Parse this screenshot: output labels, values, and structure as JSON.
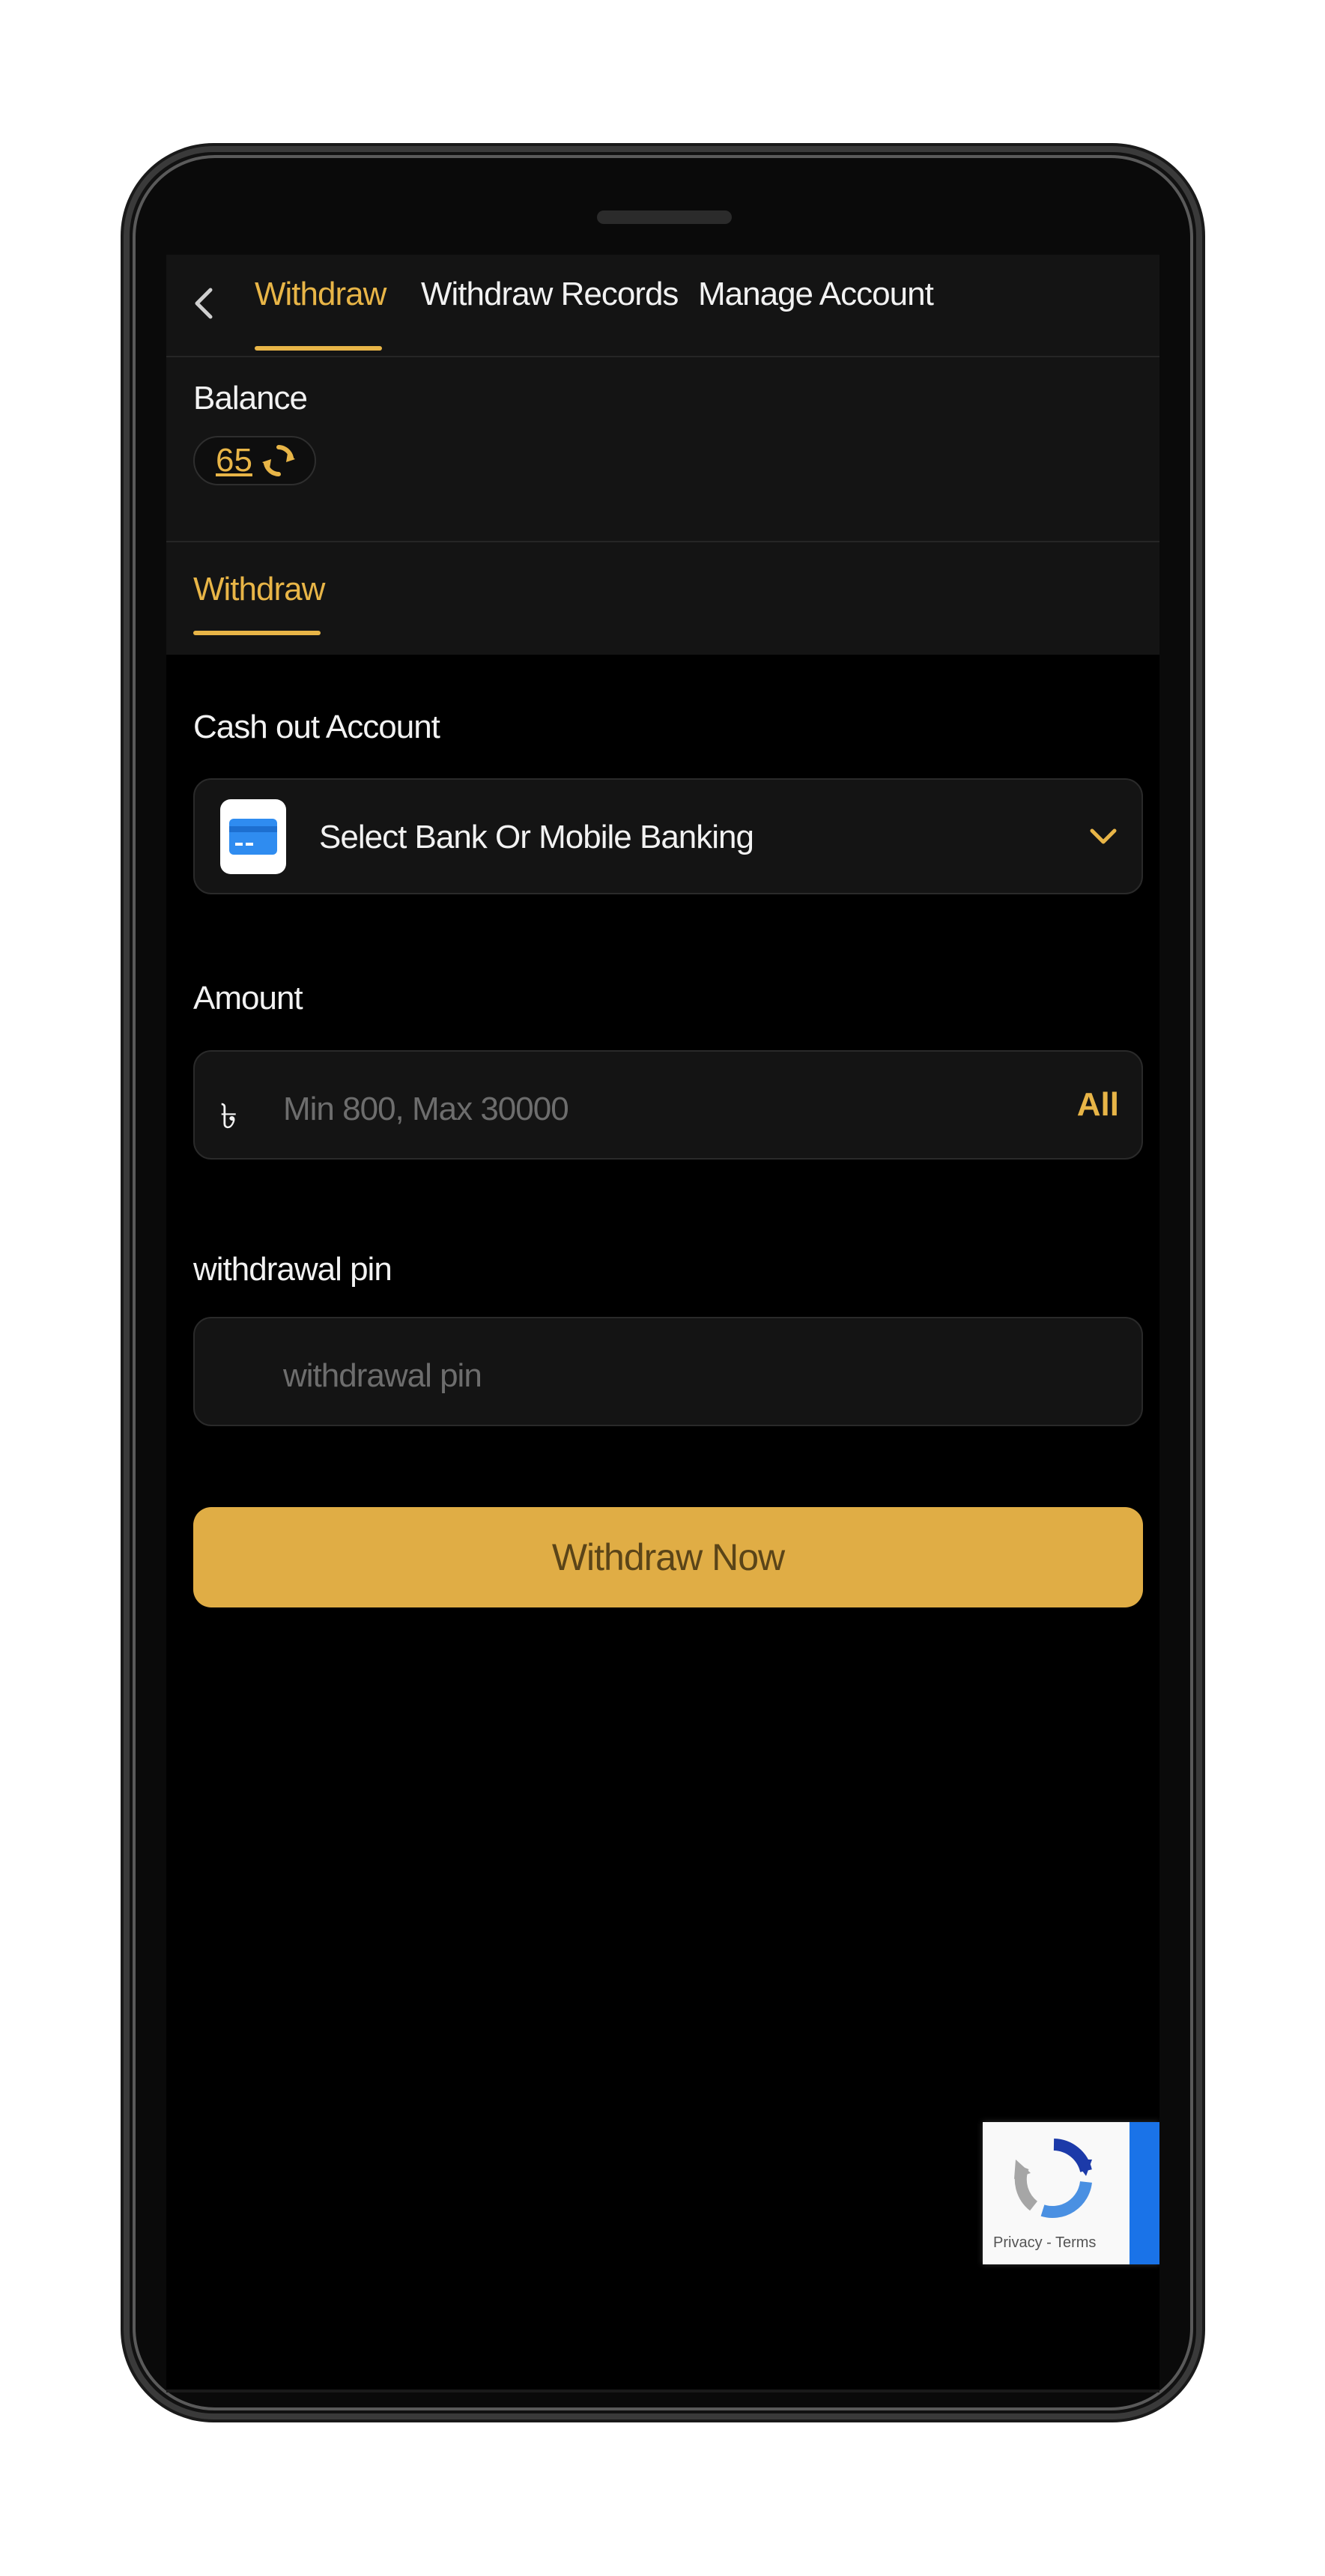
{
  "header": {
    "tabs": [
      "Withdraw",
      "Withdraw Records",
      "Manage Account"
    ],
    "active_tab": "Withdraw"
  },
  "balance": {
    "label": "Balance",
    "value": "65"
  },
  "section_tab": "Withdraw",
  "form": {
    "cash_out_label": "Cash out Account",
    "bank_select_text": "Select Bank Or Mobile Banking",
    "amount_label": "Amount",
    "currency_symbol": "৳",
    "amount_placeholder": "Min 800, Max 30000",
    "all_label": "All",
    "pin_label": "withdrawal pin",
    "pin_placeholder": "withdrawal pin",
    "submit_label": "Withdraw Now"
  },
  "recaptcha": {
    "text": "Privacy - Terms"
  },
  "colors": {
    "accent": "#e8b547",
    "button": "#e0ad45",
    "background": "#000000",
    "panel": "#141414"
  }
}
